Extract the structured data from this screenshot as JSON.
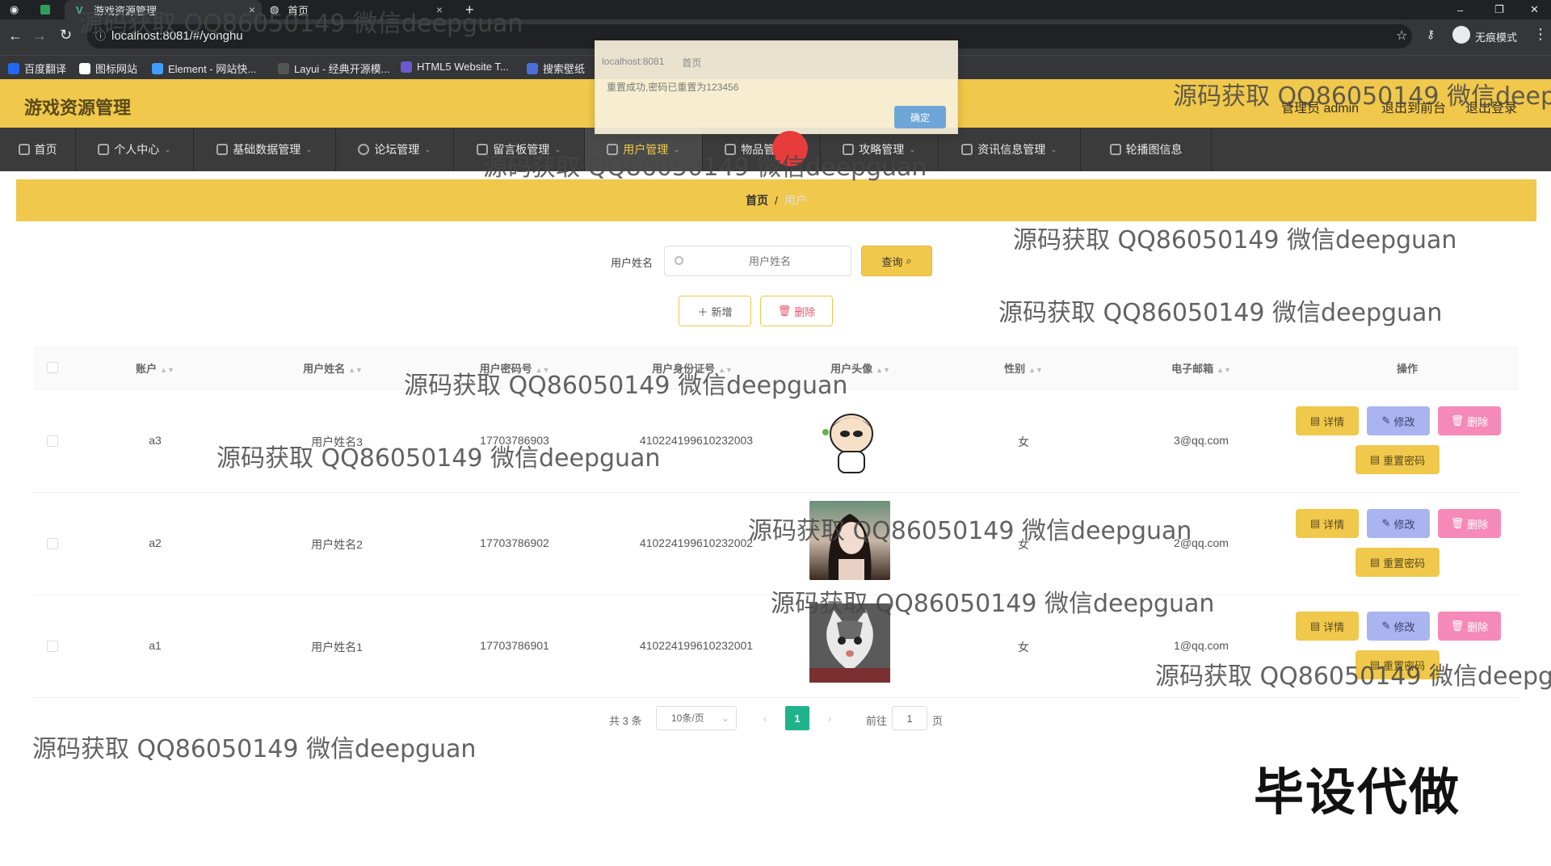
{
  "browser": {
    "tabs": [
      {
        "label": "游戏资源管理",
        "close": "×"
      },
      {
        "label": "首页",
        "close": "×"
      }
    ],
    "new_tab": "+",
    "url": "localhost:8081/#/yonghu",
    "incognito": "无痕模式",
    "bookmarks": [
      "百度翻译",
      "图标网站",
      "Element - 网站快...",
      "Layui - 经典开源模...",
      "HTML5 Website T...",
      "搜索壁纸"
    ],
    "window_controls": [
      "–",
      "❐",
      "✕"
    ]
  },
  "dialog": {
    "tabs": [
      "localhost:8081",
      "首页"
    ],
    "message": "重置成功,密码已重置为123456",
    "ok_label": "确定"
  },
  "header": {
    "title": "游戏资源管理",
    "admin_label": "管理员 admin",
    "back_front": "退出到前台",
    "logout": "退出登录"
  },
  "nav": [
    {
      "label": "首页"
    },
    {
      "label": "个人中心"
    },
    {
      "label": "基础数据管理"
    },
    {
      "label": "论坛管理"
    },
    {
      "label": "留言板管理"
    },
    {
      "label": "用户管理"
    },
    {
      "label": "物品管理"
    },
    {
      "label": "攻略管理"
    },
    {
      "label": "资讯信息管理"
    },
    {
      "label": "轮播图信息"
    }
  ],
  "breadcrumb": {
    "home": "首页",
    "sep": "/",
    "current": "用户"
  },
  "search": {
    "label": "用户姓名",
    "placeholder": "用户姓名",
    "query_label": "查询"
  },
  "actions": {
    "add": "新增",
    "delete": "删除"
  },
  "table": {
    "columns": [
      "账户",
      "用户姓名",
      "用户密码号",
      "用户身份证号",
      "用户头像",
      "性别",
      "电子邮箱",
      "操作"
    ],
    "rows": [
      {
        "account": "a3",
        "name": "用户姓名3",
        "phone": "17703786903",
        "id_card": "410224199610232003",
        "gender": "女",
        "email": "3@qq.com"
      },
      {
        "account": "a2",
        "name": "用户姓名2",
        "phone": "17703786902",
        "id_card": "410224199610232002",
        "gender": "女",
        "email": "2@qq.com"
      },
      {
        "account": "a1",
        "name": "用户姓名1",
        "phone": "17703786901",
        "id_card": "410224199610232001",
        "gender": "女",
        "email": "1@qq.com"
      }
    ],
    "op_labels": {
      "detail": "详情",
      "edit": "修改",
      "delete": "删除",
      "reset": "重置密码"
    }
  },
  "pagination": {
    "total": "共 3 条",
    "page_size": "10条/页",
    "current_page": "1",
    "goto_label": "前往",
    "goto_value": "1",
    "page_suffix": "页"
  },
  "watermark_text": "源码获取 QQ86050149 微信deepguan",
  "stamp_text": "毕设代做",
  "colors": {
    "accent": "#f0c84b",
    "nav_bg": "#3b3b3b",
    "page_active": "#20b28a",
    "delete": "#f58ab8",
    "edit": "#a9b4f0"
  }
}
